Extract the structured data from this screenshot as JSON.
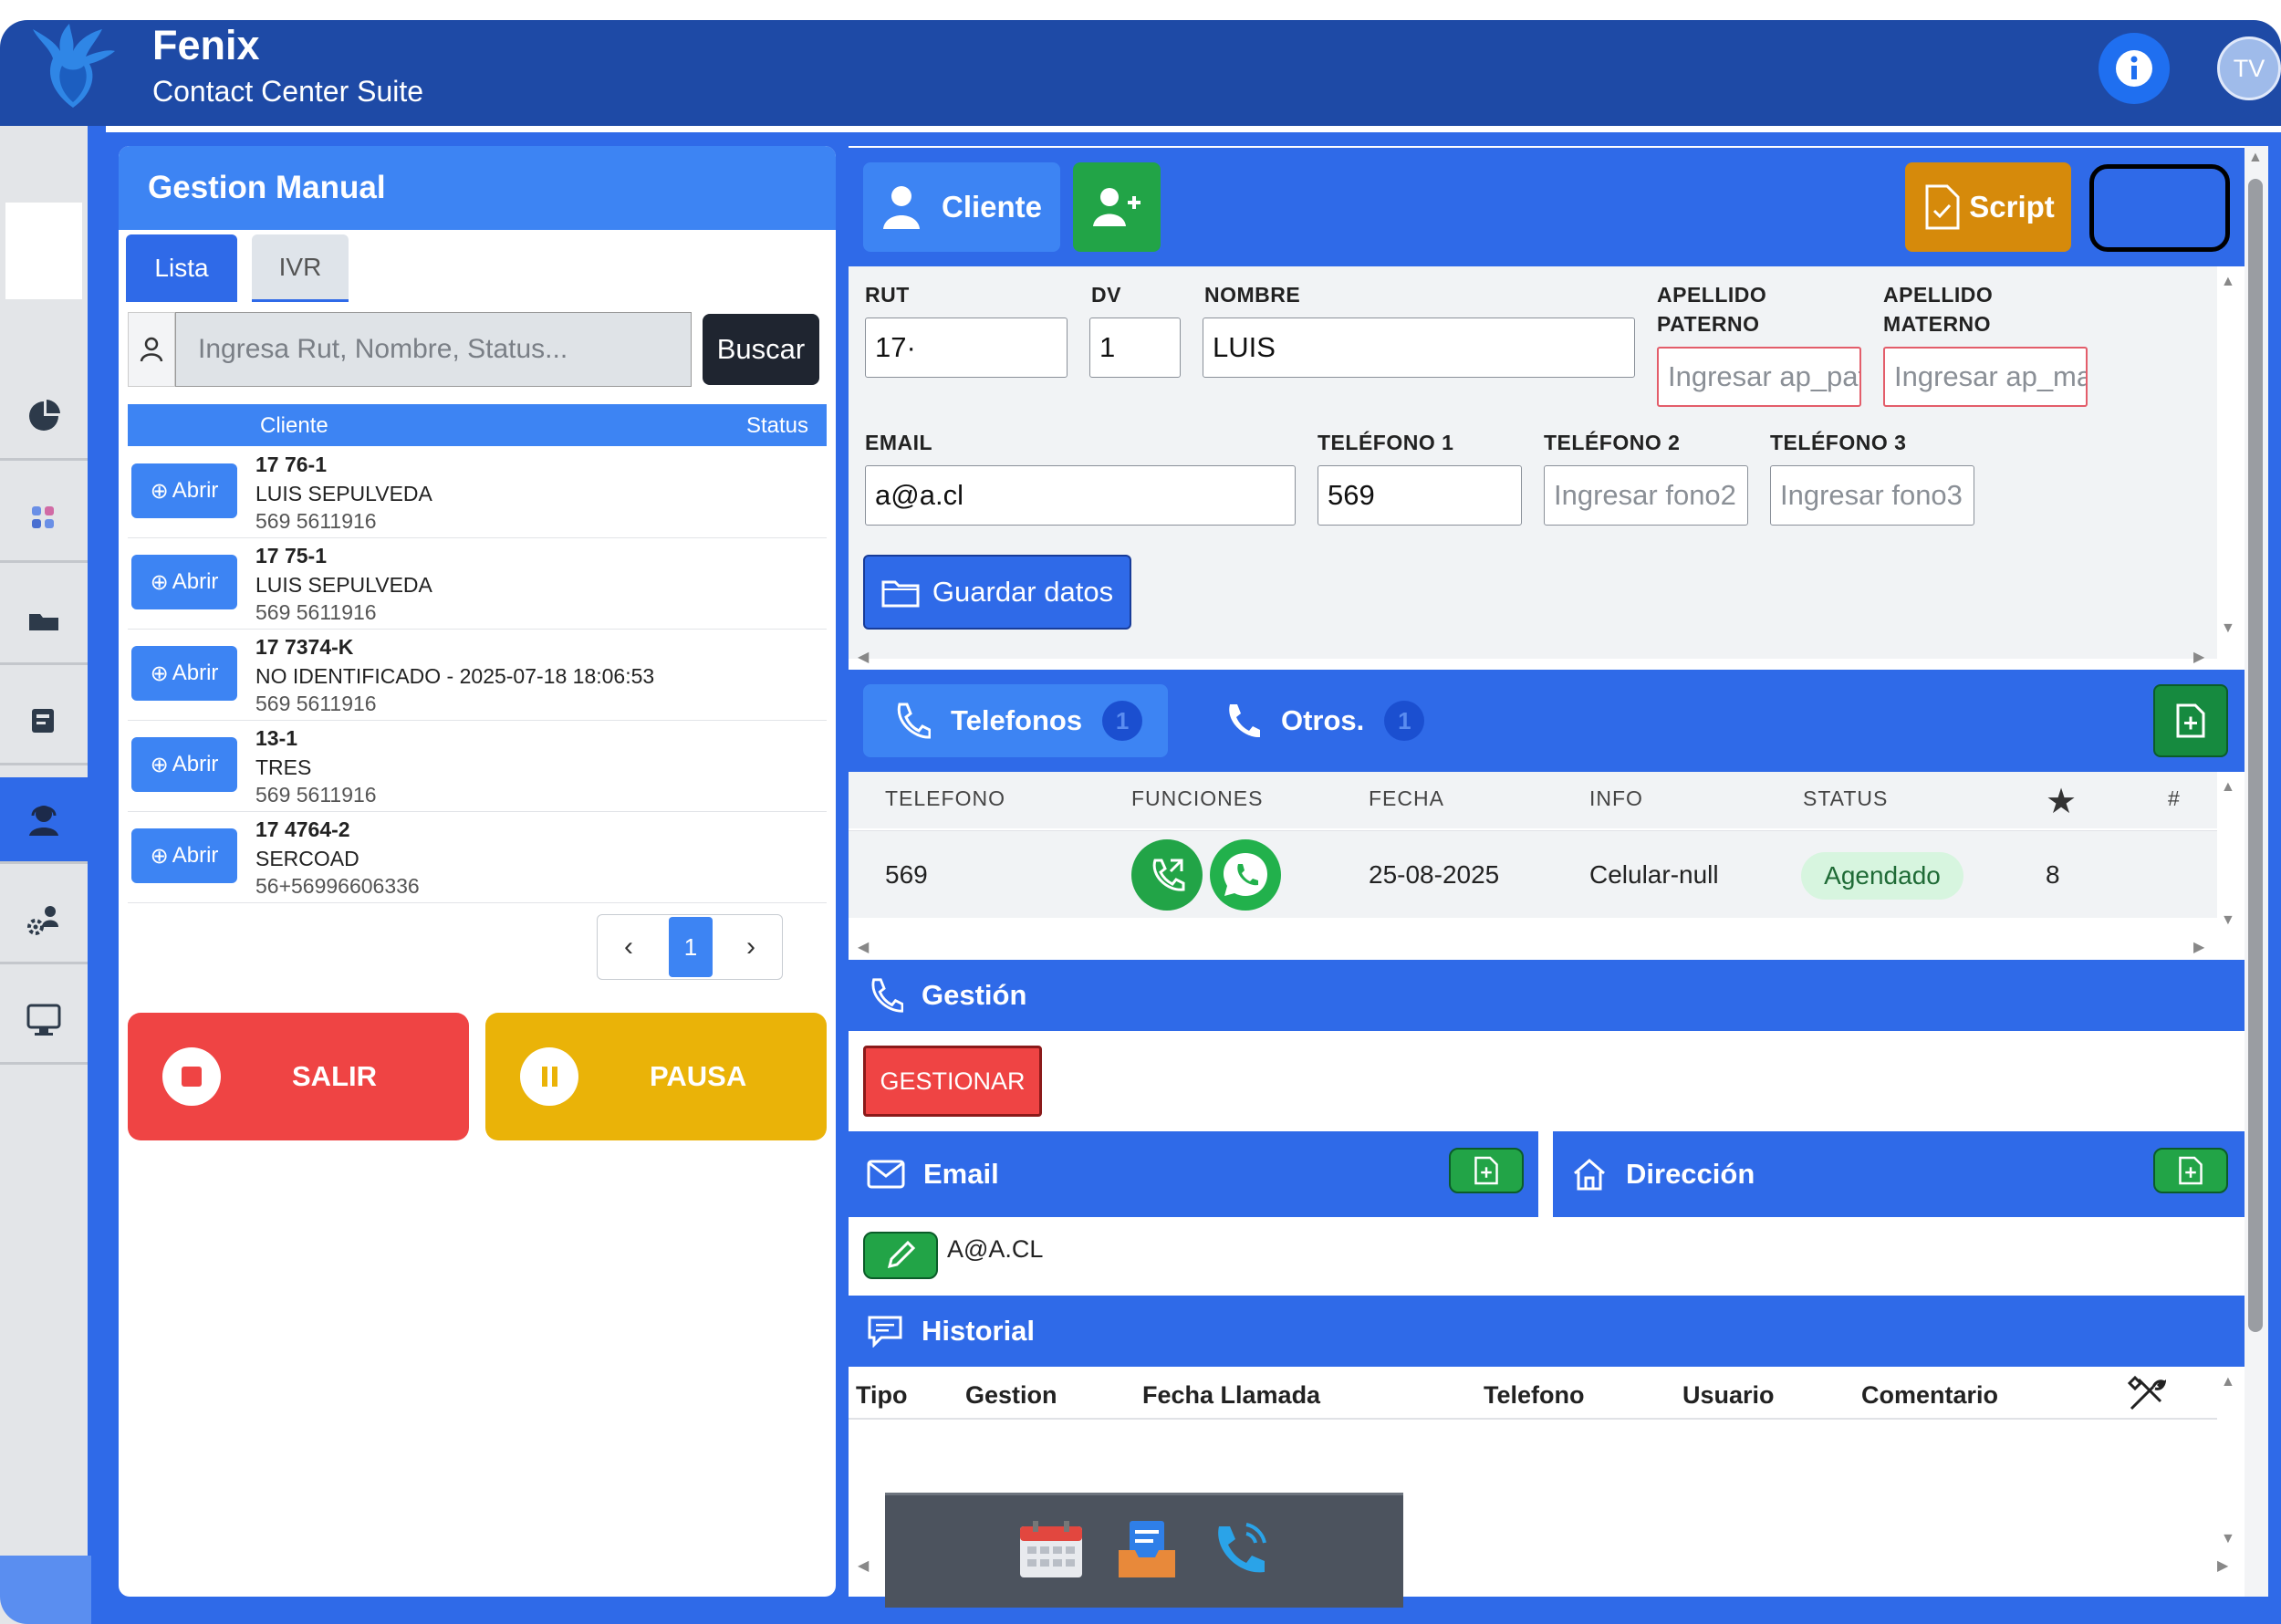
{
  "app": {
    "title": "Fenix",
    "subtitle": "Contact Center Suite",
    "avatar_initials": "TV"
  },
  "left": {
    "title": "Gestion Manual",
    "tabs": [
      "Lista",
      "IVR"
    ],
    "search_placeholder": "Ingresa Rut, Nombre, Status...",
    "search_button": "Buscar",
    "columns": {
      "cliente": "Cliente",
      "status": "Status"
    },
    "open_label": "Abrir",
    "rows": [
      {
        "l1": "17        76-1",
        "l2": "LUIS SEPULVEDA",
        "l3": "569  5611916"
      },
      {
        "l1": "17        75-1",
        "l2": "LUIS SEPULVEDA",
        "l3": "569  5611916"
      },
      {
        "l1": "17    7374-K",
        "l2": "NO IDENTIFICADO - 2025-07-18 18:06:53",
        "l3": "569  5611916"
      },
      {
        "l1": "13-1",
        "l2": "TRES",
        "l3": "569  5611916"
      },
      {
        "l1": "17    4764-2",
        "l2": "SERCOAD",
        "l3": "56+56996606336"
      }
    ],
    "pager": {
      "prev": "‹",
      "current": "1",
      "next": "›"
    },
    "salir": "SALIR",
    "pausa": "PAUSA"
  },
  "cliente": {
    "tab_label": "Cliente",
    "script_label": "Script",
    "labels": {
      "rut": "RUT",
      "dv": "DV",
      "nombre": "NOMBRE",
      "ap_paterno_1": "APELLIDO",
      "ap_paterno_2": "PATERNO",
      "ap_materno_1": "APELLIDO",
      "ap_materno_2": "MATERNO",
      "email": "EMAIL",
      "tel1": "TELÉFONO 1",
      "tel2": "TELÉFONO 2",
      "tel3": "TELÉFONO 3"
    },
    "values": {
      "rut": "17·",
      "dv": "1",
      "nombre": "LUIS",
      "email": "a@a.cl",
      "tel1": "569"
    },
    "placeholders": {
      "ap_paterno": "Ingresar ap_paterno",
      "ap_materno": "Ingresar ap_materno",
      "tel2": "Ingresar fono2",
      "tel3": "Ingresar fono3"
    },
    "save_label": "Guardar datos"
  },
  "telefonos": {
    "tab_label": "Telefonos",
    "tab_count": "1",
    "otros_label": "Otros.",
    "otros_count": "1",
    "columns": [
      "TELEFONO",
      "FUNCIONES",
      "FECHA",
      "INFO",
      "STATUS",
      "#"
    ],
    "row": {
      "telefono": "569",
      "fecha": "25-08-2025",
      "info": "Celular-null",
      "status": "Agendado",
      "count": "8"
    }
  },
  "gestion": {
    "title": "Gestión",
    "button": "GESTIONAR"
  },
  "email": {
    "title": "Email",
    "value": "A@A.CL"
  },
  "direccion": {
    "title": "Dirección"
  },
  "historial": {
    "title": "Historial",
    "columns": [
      "Tipo",
      "Gestion",
      "Fecha Llamada",
      "Telefono",
      "Usuario",
      "Comentario"
    ]
  },
  "colors": {
    "header": "#1e4aa6",
    "primary": "#2f6ae8",
    "light_primary": "#3d84f3",
    "success": "#22a447",
    "danger": "#ef4444",
    "warning": "#eab308",
    "script": "#d68a0b"
  }
}
